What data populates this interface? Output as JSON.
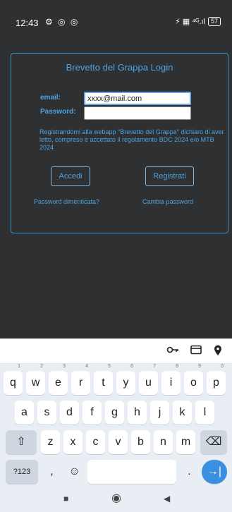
{
  "status": {
    "time": "12:43",
    "left_icons": "⚙ ◎ ◎",
    "signal_text": "⚡ ▦ ⁴ᴳ.ıl",
    "battery": "57"
  },
  "login": {
    "title": "Brevetto del Grappa Login",
    "email_label": "email:",
    "email_value": "xxxx@mail.com",
    "password_label": "Password:",
    "notice": "Registrandomi alla webapp \"Brevetto del Grappa\" dichiaro di aver letto, compreso e accettato il regolamento BDC 2024 e/o MTB 2024",
    "login_button": "Accedi",
    "register_button": "Registrati",
    "forgot_link": "Password dimenticata?",
    "change_link": "Cambia password"
  },
  "keyboard": {
    "toolbar_icons": [
      "key-icon",
      "card-icon",
      "location-icon"
    ],
    "row1": [
      {
        "k": "q",
        "h": "1"
      },
      {
        "k": "w",
        "h": "2"
      },
      {
        "k": "e",
        "h": "3"
      },
      {
        "k": "r",
        "h": "4"
      },
      {
        "k": "t",
        "h": "5"
      },
      {
        "k": "y",
        "h": "6"
      },
      {
        "k": "u",
        "h": "7"
      },
      {
        "k": "i",
        "h": "8"
      },
      {
        "k": "o",
        "h": "9"
      },
      {
        "k": "p",
        "h": "0"
      }
    ],
    "row2": [
      "a",
      "s",
      "d",
      "f",
      "g",
      "h",
      "j",
      "k",
      "l"
    ],
    "row3": [
      "z",
      "x",
      "c",
      "v",
      "b",
      "n",
      "m"
    ],
    "symbols_key": "?123",
    "comma_key": ",",
    "period_key": ".",
    "emoji_icon": "☺",
    "shift_icon": "⇧",
    "backspace_icon": "⌫",
    "enter_icon": "→|"
  },
  "nav": {
    "square_icon": "■",
    "circle_icon": "◉",
    "back_icon": "◀"
  }
}
